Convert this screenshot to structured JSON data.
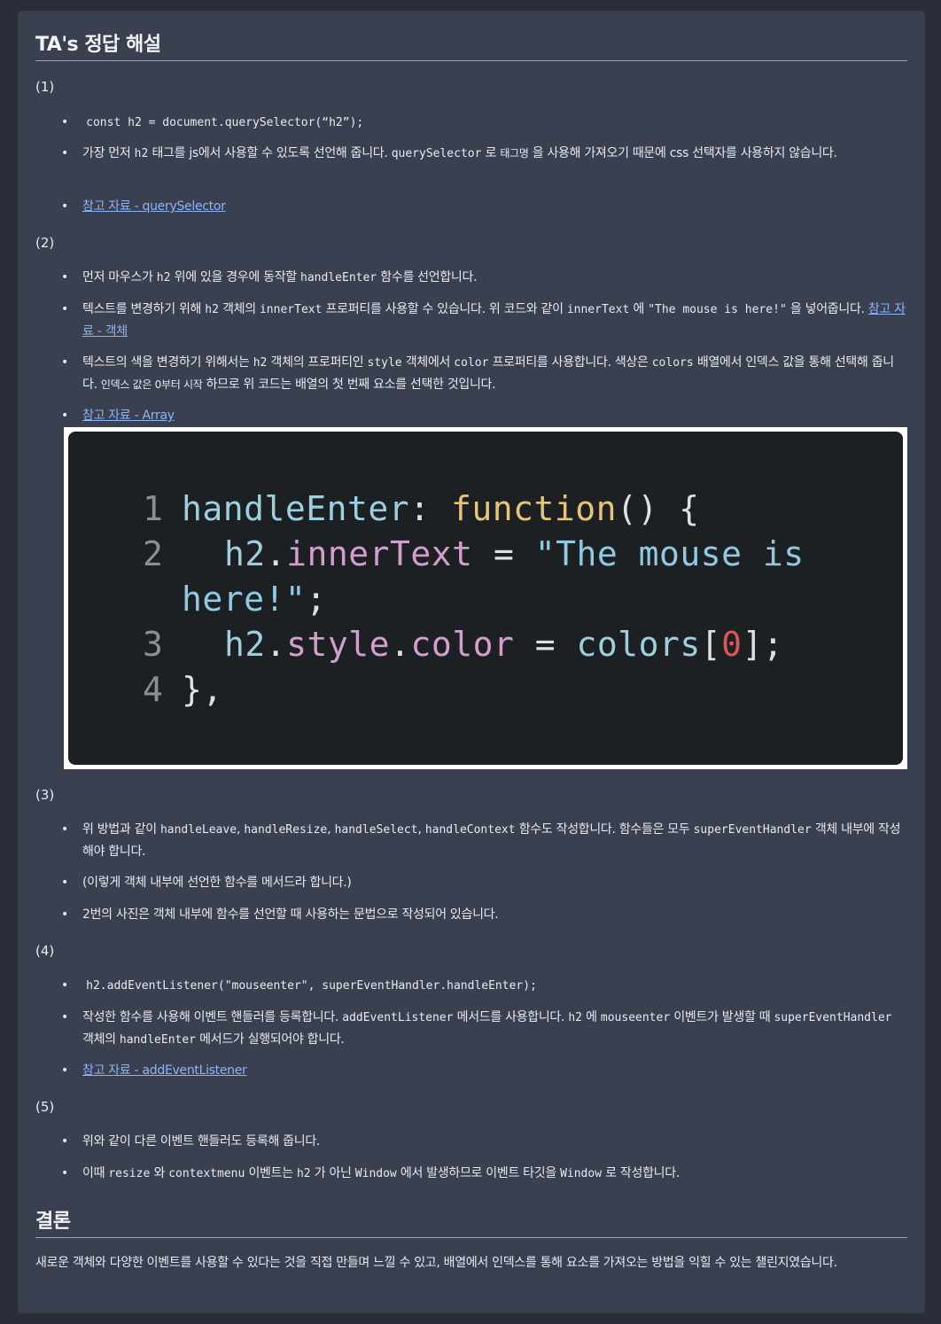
{
  "title": "TA's 정답 해설",
  "sections": {
    "s1": "(1)",
    "s2": "(2)",
    "s3": "(3)",
    "s4": "(4)",
    "s5": "(5)"
  },
  "s1": {
    "code": "const h2 = document.querySelector(“h2”);",
    "b2_a": "가장 먼저",
    "b2_code1": "h2",
    "b2_b": "태그를 js에서 사용할 수 있도록 선언해 줍니다.",
    "b2_code2": "querySelector",
    "b2_c": "로",
    "b2_small": "태그명",
    "b2_d": "을 사용해 가져오기 때문에 css 선택자를 사용하지 않습니다.",
    "link": "참고 자료 - querySelector"
  },
  "s2": {
    "b1_a": "먼저 마우스가",
    "b1_code1": "h2",
    "b1_b": "위에 있을 경우에 동작할",
    "b1_code2": "handleEnter",
    "b1_c": "함수를 선언합니다.",
    "b2_a": "텍스트를 변경하기 위해",
    "b2_code1": "h2",
    "b2_b": "객체의",
    "b2_code2": "innerText",
    "b2_c": "프로퍼티를 사용할 수 있습니다. 위 코드와 같이",
    "b2_code3": "innerText",
    "b2_d": "에",
    "b2_code4": "\"The mouse is here!\"",
    "b2_e": "을 넣어줍니다.",
    "b2_link": "참고 자료 - 객체",
    "b3_a": "텍스트의 색을 변경하기 위해서는",
    "b3_code1": "h2",
    "b3_b": "객체의 프로퍼티인",
    "b3_code2": "style",
    "b3_c": "객체에서",
    "b3_code3": "color",
    "b3_d": "프로퍼티를 사용합니다. 색상은",
    "b3_code4": "colors",
    "b3_e": "배열에서 인덱스 값을 통해 선택해 줍니다.",
    "b3_small": "인덱스 값은 0부터 시작",
    "b3_f": "하므로 위 코드는 배열의 첫 번째 요소를 선택한 것입니다.",
    "link": "참고 자료 - Array"
  },
  "code_image": {
    "l1": "1",
    "l1_a": "handleEnter",
    "l1_b": ":",
    "l1_c": "function",
    "l1_d": "() {",
    "l2": "2",
    "l2_a": "h2",
    "l2_b": ".",
    "l2_c": "innerText",
    "l2_d": "=",
    "l2_e": "\"The mouse is",
    "l2_f": "here!\"",
    "l2_g": ";",
    "l3": "3",
    "l3_a": "h2",
    "l3_b": ".",
    "l3_c": "style",
    "l3_d": ".",
    "l3_e": "color",
    "l3_f": "=",
    "l3_g": "colors",
    "l3_h": "[",
    "l3_i": "0",
    "l3_j": "];",
    "l4": "4",
    "l4_a": "},"
  },
  "s3": {
    "b1_a": "위 방법과 같이",
    "b1_code1": "handleLeave",
    "b1_code2": "handleResize",
    "b1_code3": "handleSelect",
    "b1_code4": "handleContext",
    "b1_b": "함수도 작성합니다. 함수들은 모두",
    "b1_code5": "superEventHandler",
    "b1_c": "객체 내부에 작성해야 합니다.",
    "b2": "(이렇게 객체 내부에 선언한 함수를 메서드라 합니다.)",
    "b3": "2번의 사진은 객체 내부에 함수를 선언할 때 사용하는 문법으로 작성되어 있습니다."
  },
  "s4": {
    "code": "h2.addEventListener(\"mouseenter\", superEventHandler.handleEnter);",
    "b2_a": "작성한 함수를 사용해 이벤트 핸들러를 등록합니다.",
    "b2_code1": "addEventListener",
    "b2_b": "메서드를 사용합니다.",
    "b2_code2": "h2",
    "b2_c": "에",
    "b2_code3": "mouseenter",
    "b2_d": "이벤트가 발생할 때",
    "b2_code4": "superEventHandler",
    "b2_e": "객체의",
    "b2_code5": "handleEnter",
    "b2_f": "메서드가 실행되어야 합니다.",
    "link": "참고 자료 - addEventListener"
  },
  "s5": {
    "b1": "위와 같이 다른 이벤트 핸들러도 등록해 줍니다.",
    "b2_a": "이때",
    "b2_code1": "resize",
    "b2_b": "와",
    "b2_code2": "contextmenu",
    "b2_c": "이벤트는",
    "b2_code3": "h2",
    "b2_d": "가 아닌",
    "b2_code4": "Window",
    "b2_e": "에서 발생하므로 이벤트 타깃을",
    "b2_code5": "Window",
    "b2_f": "로 작성합니다."
  },
  "conclusion": {
    "title": "결론",
    "text": "새로운 객체와 다양한 이벤트를 사용할 수 있다는 것을 직접 만들며 느낄 수 있고, 배열에서 인덱스를 통해 요소를 가져오는 방법을 익힐 수 있는 챌린지였습니다."
  }
}
